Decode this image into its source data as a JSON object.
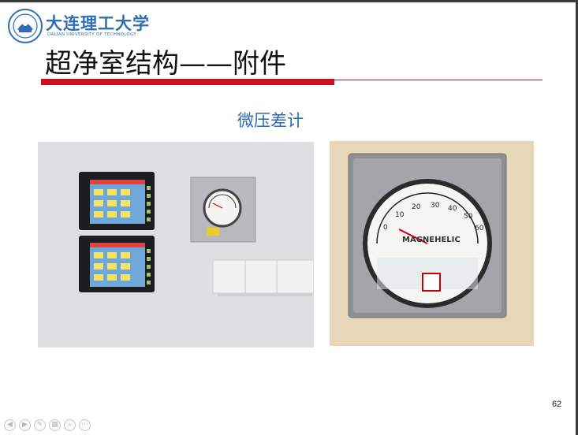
{
  "header": {
    "logo_cn": "大连理工大学",
    "logo_en": "DALIAN UNIVERSITY OF TECHNOLOGY"
  },
  "slide": {
    "title": "超净室结构——附件",
    "caption": "微压差计",
    "page_number": "62"
  },
  "gauge": {
    "scale_labels": [
      "0",
      "10",
      "20",
      "30",
      "40",
      "50",
      "60"
    ],
    "brand": "MAGNEHELIC"
  },
  "toolbar": {
    "icons": [
      "prev-icon",
      "next-icon",
      "pen-icon",
      "slides-icon",
      "zoom-icon",
      "more-icon"
    ]
  },
  "colors": {
    "accent_red": "#c8101f",
    "title_blue": "#2e6ab3",
    "logo_blue": "#2d6fb7"
  }
}
